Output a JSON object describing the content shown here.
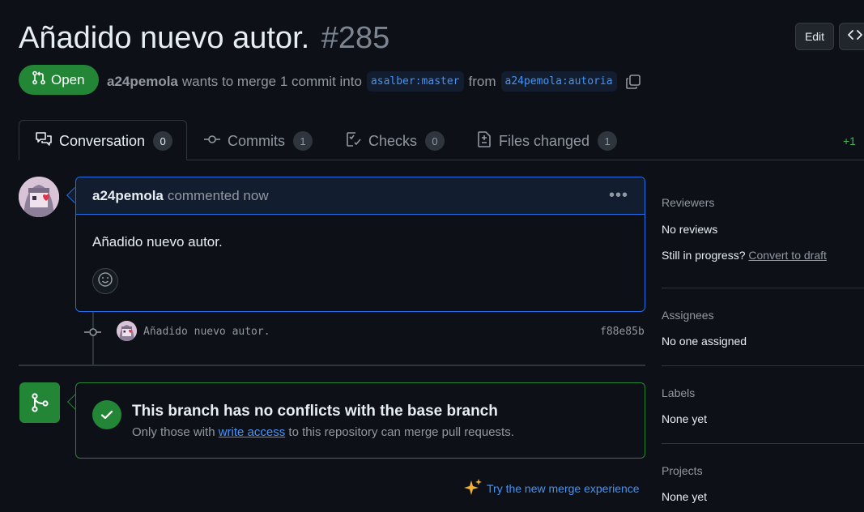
{
  "pr": {
    "title": "Añadido nuevo autor.",
    "number": "#285",
    "state": "Open",
    "author": "a24pemola",
    "wants_text": "wants to merge 1 commit into",
    "base_ref": "asalber:master",
    "from_text": "from",
    "head_ref": "a24pemola:autoria"
  },
  "header_actions": {
    "edit_label": "Edit",
    "code_icon": "code-icon"
  },
  "tabs": [
    {
      "label": "Conversation",
      "count": "0",
      "icon": "comment-discussion-icon"
    },
    {
      "label": "Commits",
      "count": "1",
      "icon": "git-commit-icon"
    },
    {
      "label": "Checks",
      "count": "0",
      "icon": "checklist-icon"
    },
    {
      "label": "Files changed",
      "count": "1",
      "icon": "file-diff-icon"
    }
  ],
  "diffstat": "+1",
  "comment": {
    "author": "a24pemola",
    "action": "commented now",
    "body": "Añadido nuevo autor."
  },
  "commit": {
    "message": "Añadido nuevo autor.",
    "sha": "f88e85b"
  },
  "merge": {
    "title": "This branch has no conflicts with the base branch",
    "sub_prefix": "Only those with",
    "sub_link": "write access",
    "sub_suffix": "to this repository can merge pull requests.",
    "try_new": "Try the new merge experience"
  },
  "sidebar": {
    "reviewers_label": "Reviewers",
    "reviewers_value": "No reviews",
    "in_progress_text": "Still in progress?",
    "convert_draft": "Convert to draft",
    "assignees_label": "Assignees",
    "assignees_value": "No one assigned",
    "labels_label": "Labels",
    "labels_value": "None yet",
    "projects_label": "Projects",
    "projects_value": "None yet"
  },
  "colors": {
    "background": "#0d1117",
    "accent_green": "#238636",
    "link_blue": "#4493f8",
    "muted": "#9198a1"
  }
}
